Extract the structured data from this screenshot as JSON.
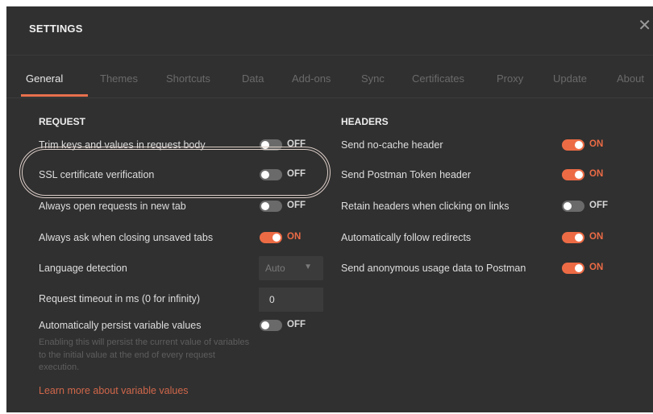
{
  "dialog": {
    "title": "SETTINGS",
    "close_glyph": "✕"
  },
  "tabs": [
    {
      "label": "General"
    },
    {
      "label": "Themes"
    },
    {
      "label": "Shortcuts"
    },
    {
      "label": "Data"
    },
    {
      "label": "Add-ons"
    },
    {
      "label": "Sync"
    },
    {
      "label": "Certificates"
    },
    {
      "label": "Proxy"
    },
    {
      "label": "Update"
    },
    {
      "label": "About"
    }
  ],
  "active_tab": "General",
  "request": {
    "title": "REQUEST",
    "trim_keys": {
      "label": "Trim keys and values in request body",
      "state": "OFF"
    },
    "ssl": {
      "label": "SSL certificate verification",
      "state": "OFF"
    },
    "new_tab": {
      "label": "Always open requests in new tab",
      "state": "OFF"
    },
    "ask_close": {
      "label": "Always ask when closing unsaved tabs",
      "state": "ON"
    },
    "language": {
      "label": "Language detection",
      "value": "Auto"
    },
    "timeout": {
      "label": "Request timeout in ms (0 for infinity)",
      "value": "0"
    },
    "persist": {
      "label": "Automatically persist variable values",
      "state": "OFF",
      "helper": "Enabling this will persist the current value of variables to the initial value at the end of every request execution.",
      "link": "Learn more about variable values"
    }
  },
  "headers": {
    "title": "HEADERS",
    "no_cache": {
      "label": "Send no-cache header",
      "state": "ON"
    },
    "postman_token": {
      "label": "Send Postman Token header",
      "state": "ON"
    },
    "retain_headers": {
      "label": "Retain headers when clicking on links",
      "state": "OFF"
    },
    "follow_redirects": {
      "label": "Automatically follow redirects",
      "state": "ON"
    },
    "anon_usage": {
      "label": "Send anonymous usage data to Postman",
      "state": "ON"
    }
  },
  "colors": {
    "accent": "#ec6b45",
    "background": "#303030",
    "toggle_off": "#6a6a6a"
  }
}
